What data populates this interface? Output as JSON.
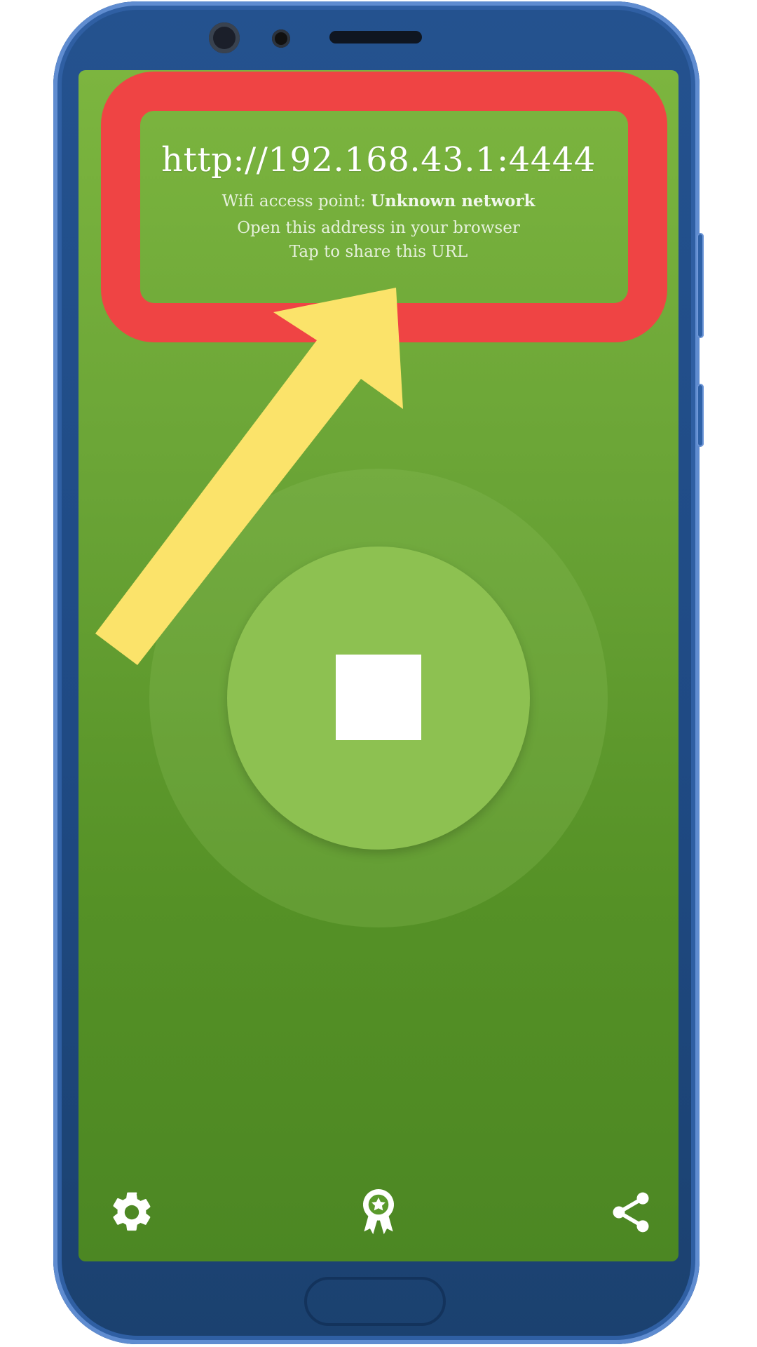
{
  "server": {
    "url": "http://192.168.43.1:4444",
    "wifi_label": "Wifi access point: ",
    "wifi_network": "Unknown network",
    "open_hint": "Open this address in your browser",
    "share_hint": "Tap to share this URL"
  },
  "controls": {
    "stop_icon": "stop-icon"
  },
  "bottom_bar": {
    "items": [
      {
        "icon": "gear-icon"
      },
      {
        "icon": "award-ribbon-icon"
      },
      {
        "icon": "share-icon"
      }
    ]
  },
  "annotation": {
    "highlight_color": "#ef4444",
    "arrow_color": "#fbe36a"
  },
  "theme": {
    "screen_green_top": "#7cb53f",
    "screen_green_bottom": "#4c8723",
    "button_green": "#8dc151",
    "phone_blue": "#24528f"
  }
}
